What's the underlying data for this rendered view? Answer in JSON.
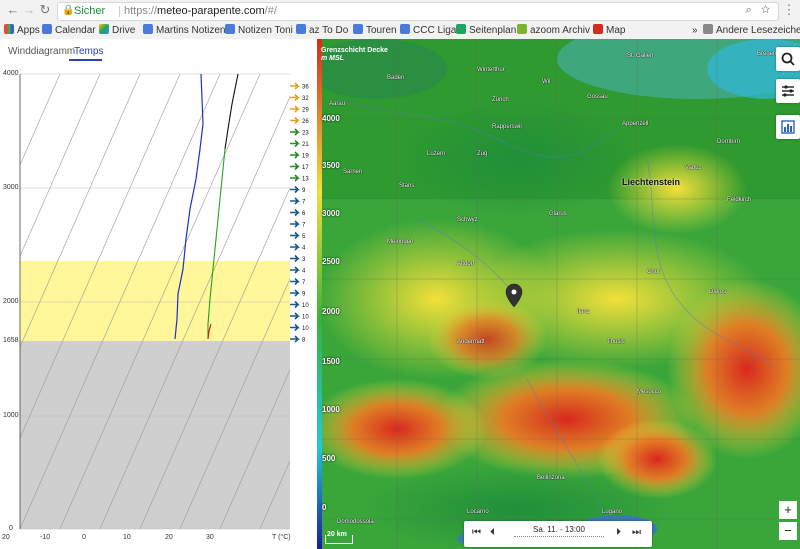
{
  "browser": {
    "secure_label": "Sicher",
    "url_scheme": "https://",
    "url_host": "meteo-parapente.com",
    "url_path": "/#/",
    "bookmarks": [
      "Apps",
      "Calendar",
      "Drive",
      "Martins Notizen",
      "Notizen Toni",
      "az To Do",
      "Touren",
      "CCC Liga",
      "Seitenplan",
      "azoom Archiv",
      "Map"
    ],
    "other_bookmarks": "Andere Lesezeichen",
    "overflow": "»"
  },
  "left_panel": {
    "tabs": [
      "Winddiagramm",
      "Temps"
    ],
    "active_tab": "Temps",
    "y_ticks": [
      "4000",
      "3000",
      "2000",
      "1000",
      "0"
    ],
    "ground_label": "1658",
    "x_ticks": [
      "20",
      "-10",
      "0",
      "10",
      "20",
      "30"
    ],
    "x_unit": "T (°C)",
    "wind_speeds": [
      "36",
      "32",
      "29",
      "26",
      "23",
      "21",
      "19",
      "17",
      "13",
      "9",
      "7",
      "6",
      "7",
      "5",
      "4",
      "3",
      "4",
      "7",
      "9",
      "10",
      "10",
      "10",
      "8"
    ],
    "zones": {
      "inversion_color": "#fff799",
      "ground_color": "#cfcfcf"
    }
  },
  "map": {
    "legend_title": "Grenzschicht Decke",
    "legend_unit": "m MSL",
    "altitudes": [
      "4000",
      "3500",
      "3000",
      "2500",
      "2000",
      "1500",
      "1000",
      "500",
      "0"
    ],
    "region_label": "Liechtenstein",
    "places": [
      "Winterthur",
      "Zürich",
      "Baden",
      "Aarau",
      "Wil",
      "Gossau",
      "Appenzell",
      "Rapperswil",
      "Luzern",
      "Zug",
      "Schwyz",
      "Glarus",
      "Altdorf",
      "Sarnen",
      "Stans",
      "Chur",
      "Vaduz",
      "Davos",
      "Bellinzona",
      "Lugano",
      "Locarno",
      "Meiringen",
      "Andermatt",
      "St. Gallen",
      "Bregenz",
      "Feldkirch",
      "Dornbirn",
      "Ilanz",
      "Thusis",
      "Mesocco",
      "Domodossola"
    ],
    "scale_label": "20 km",
    "time_label": "Sa. 11. - 13:00",
    "zoom_in": "+",
    "zoom_out": "−",
    "colors": {
      "low": "#3a6fd8",
      "mid": "#3aa63a",
      "high": "#f2e03a",
      "peak": "#d8281e"
    }
  }
}
